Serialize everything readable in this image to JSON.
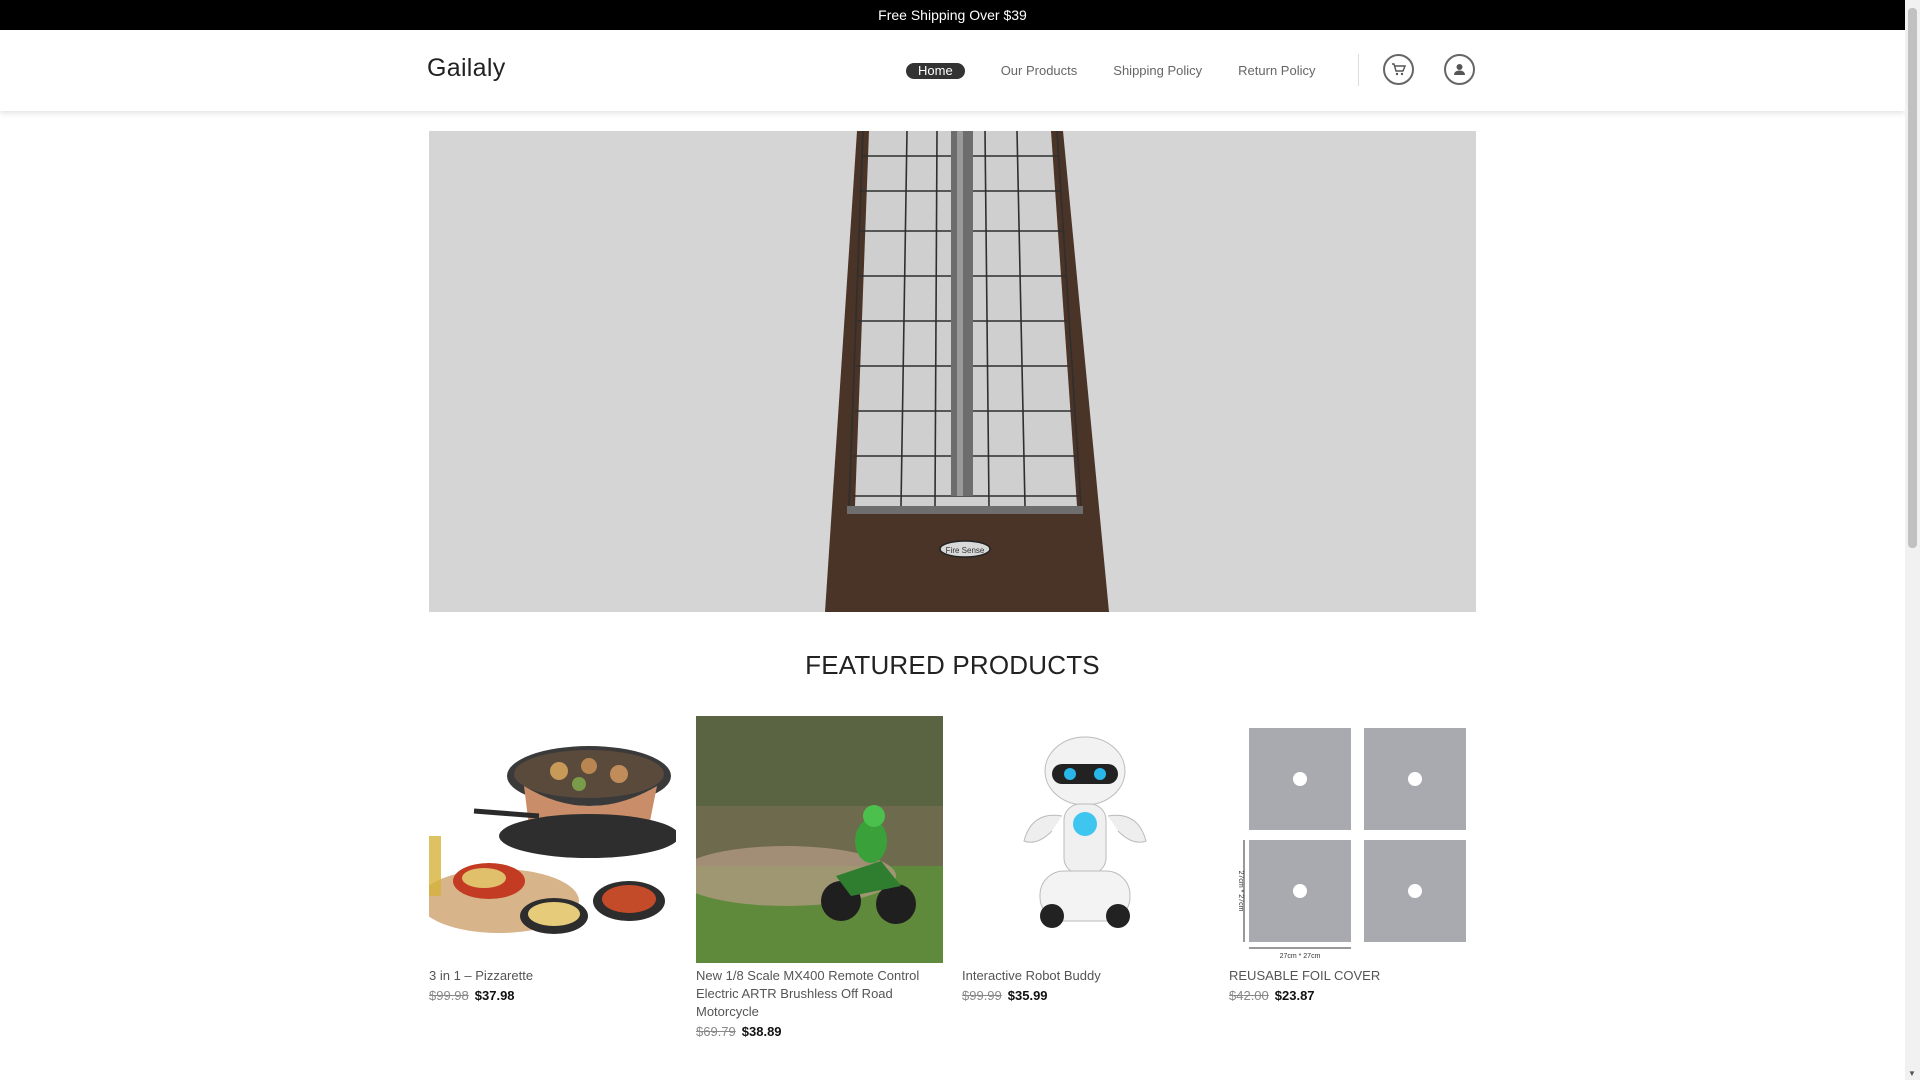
{
  "topbar": {
    "text": "Free Shipping Over $39"
  },
  "header": {
    "logo": "Gailaly",
    "nav": [
      {
        "label": "Home",
        "active": true
      },
      {
        "label": "Our Products",
        "active": false
      },
      {
        "label": "Shipping Policy",
        "active": false
      },
      {
        "label": "Return Policy",
        "active": false
      }
    ],
    "icons": {
      "cart": "cart-icon",
      "account": "user-icon"
    }
  },
  "hero": {
    "image": "patio-heater-icon",
    "badge_text": "Fire Sense"
  },
  "featured": {
    "title": "FEATURED PRODUCTS",
    "products": [
      {
        "name": "3 in 1 – Pizzarette",
        "old_price": "$99.98",
        "price": "$37.98",
        "image": "pizzarette-grill-icon"
      },
      {
        "name": "New 1/8 Scale MX400 Remote Control Electric ARTR Brushless Off Road Motorcycle",
        "old_price": "$69.79",
        "price": "$38.89",
        "image": "rc-motorcycle-icon"
      },
      {
        "name": "Interactive Robot Buddy",
        "old_price": "$99.99",
        "price": "$35.99",
        "image": "robot-icon"
      },
      {
        "name": "REUSABLE FOIL COVER",
        "old_price": "$42.00",
        "price": "$23.87",
        "image": "foil-cover-icon",
        "dimension_labels": [
          "27cm * 27cm",
          "27cm * 27cm"
        ]
      }
    ]
  },
  "colors": {
    "topbar_bg": "#000000",
    "active_nav_bg": "#333333",
    "hero_bg": "#d5d5d5"
  }
}
